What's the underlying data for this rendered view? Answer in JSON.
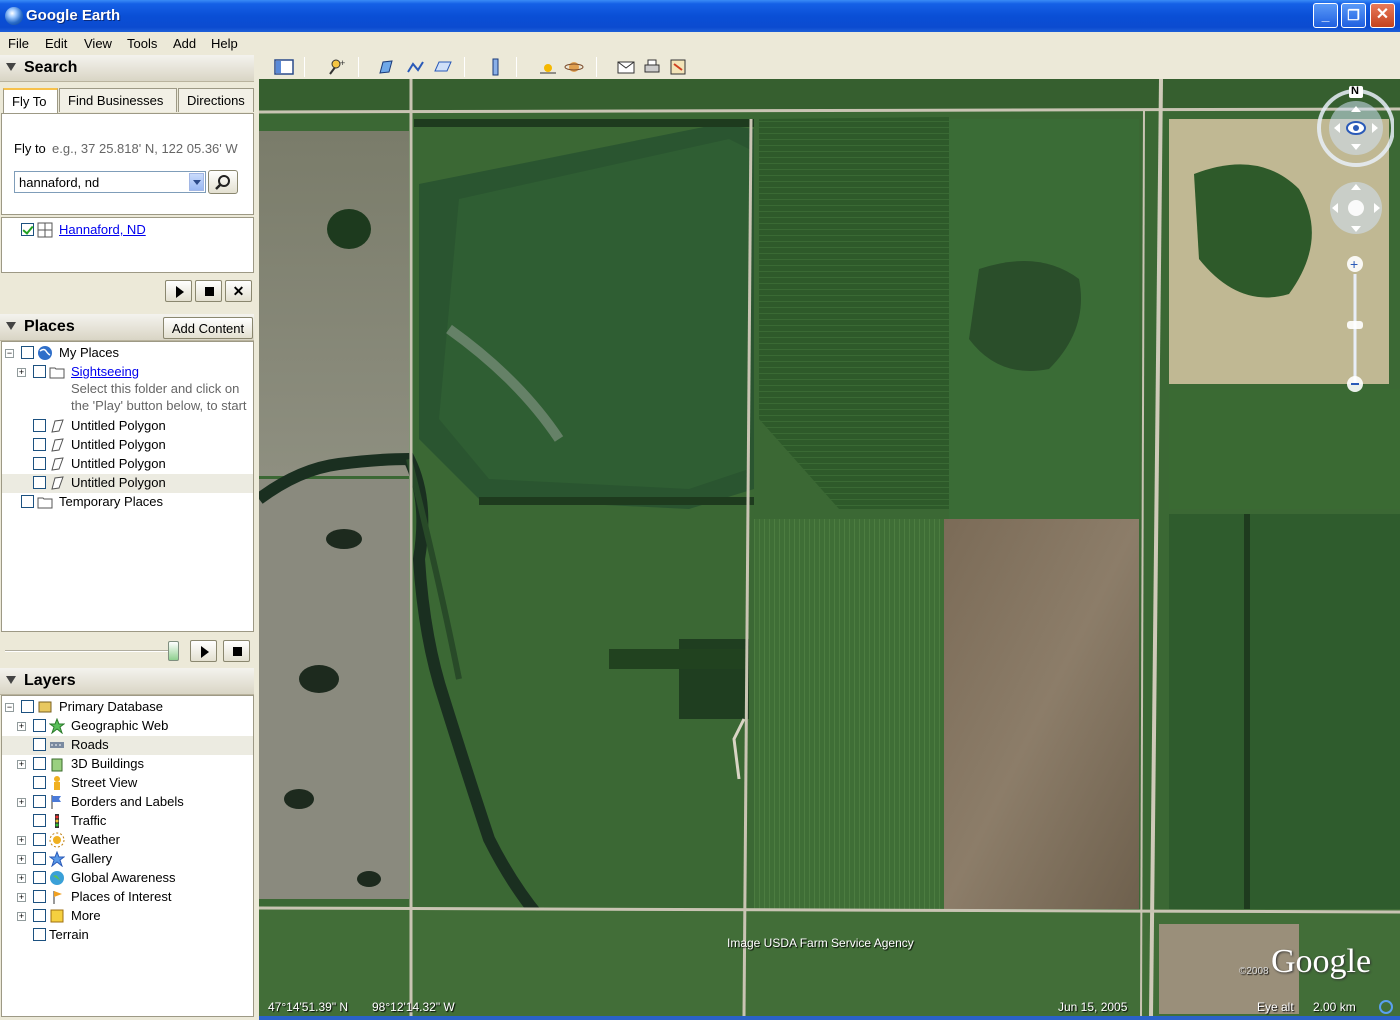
{
  "window": {
    "title": "Google Earth"
  },
  "menu": [
    "File",
    "Edit",
    "View",
    "Tools",
    "Add",
    "Help"
  ],
  "search": {
    "header": "Search",
    "tabs": [
      "Fly To",
      "Find Businesses",
      "Directions"
    ],
    "fly_to_label": "Fly to",
    "fly_to_example": "e.g., 37 25.818' N, 122 05.36' W",
    "query": "hannaford, nd",
    "result": "Hannaford, ND"
  },
  "places": {
    "header": "Places",
    "add_content": "Add Content",
    "items": [
      {
        "label": "My Places",
        "link": false
      },
      {
        "label": "Sightseeing",
        "link": true
      },
      {
        "label": "Select this folder and click on",
        "link": false
      },
      {
        "label": "the 'Play' button below, to start",
        "link": false
      },
      {
        "label": "Untitled Polygon",
        "link": false
      },
      {
        "label": "Untitled Polygon",
        "link": false
      },
      {
        "label": "Untitled Polygon",
        "link": false
      },
      {
        "label": "Untitled Polygon",
        "link": false
      },
      {
        "label": "Temporary Places",
        "link": false
      }
    ]
  },
  "layers": {
    "header": "Layers",
    "items": [
      "Primary Database",
      "Geographic Web",
      "Roads",
      "3D Buildings",
      "Street View",
      "Borders and Labels",
      "Traffic",
      "Weather",
      "Gallery",
      "Global Awareness",
      "Places of Interest",
      "More",
      "Terrain"
    ]
  },
  "map": {
    "attribution": "Image USDA Farm Service Agency",
    "copyright": "©2008",
    "logo": "Google",
    "compass_n": "N",
    "lat": "47°14'51.39\" N",
    "lon": "98°12'14.32\" W",
    "date": "Jun 15, 2005",
    "eye_alt_label": "Eye alt",
    "eye_alt_value": "2.00 km"
  },
  "colors": {
    "title_blue": "#0b4bd0",
    "panel_bg": "#ece9d8",
    "field_dark": "#2f5a2a",
    "field_mid": "#4a7a3a",
    "field_brown": "#7a6a55"
  }
}
